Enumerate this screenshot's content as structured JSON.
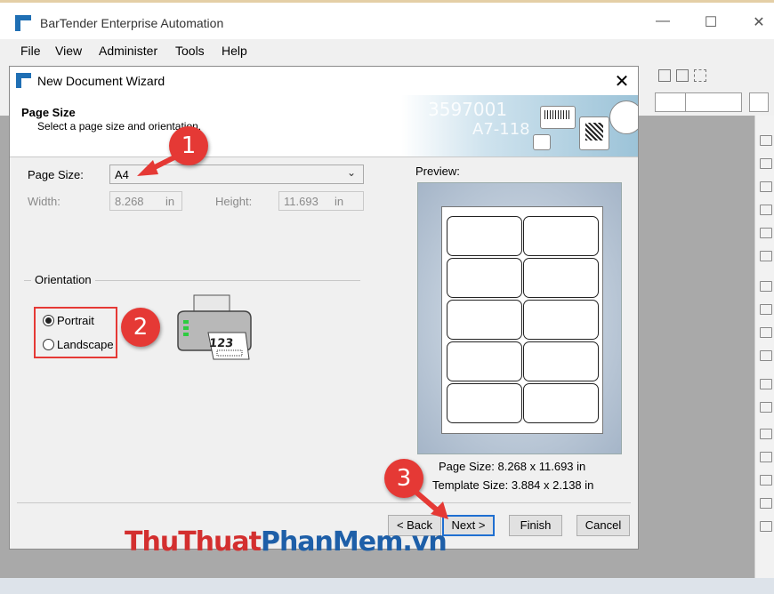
{
  "app": {
    "title": "BarTender Enterprise Automation"
  },
  "window_controls": {
    "minimize": "—",
    "maximize": "☐",
    "close": "✕"
  },
  "menu": [
    "File",
    "View",
    "Administer",
    "Tools",
    "Help"
  ],
  "dialog": {
    "title": "New Document Wizard",
    "close": "✕",
    "header": {
      "title": "Page Size",
      "subtitle": "Select a page size and orientation.",
      "banner_text_1": "3597001",
      "banner_text_2": "A7-118"
    },
    "page_size": {
      "label": "Page Size:",
      "value": "A4"
    },
    "width": {
      "label": "Width:",
      "value": "8.268",
      "unit": "in"
    },
    "height": {
      "label": "Height:",
      "value": "11.693",
      "unit": "in"
    },
    "orientation": {
      "label": "Orientation",
      "options": [
        "Portrait",
        "Landscape"
      ],
      "selected": "Portrait"
    },
    "printer_text": "123",
    "preview": {
      "label": "Preview:",
      "page_size_text": "Page Size:  8.268 x 11.693 in",
      "template_size_text": "Template Size:  3.884 x 2.138 in",
      "rows": 5,
      "cols": 2
    },
    "buttons": {
      "back": "< Back",
      "next": "Next >",
      "finish": "Finish",
      "cancel": "Cancel"
    }
  },
  "annotations": {
    "step1": "1",
    "step2": "2",
    "step3": "3",
    "color": "#e53935"
  },
  "watermark": {
    "part1": "Thu",
    "part2": "Thuat",
    "part3": "Phan",
    "part4": "Mem",
    "part5": ".vn",
    "color_red": "#d32f2f",
    "color_blue": "#1e5fa8"
  }
}
